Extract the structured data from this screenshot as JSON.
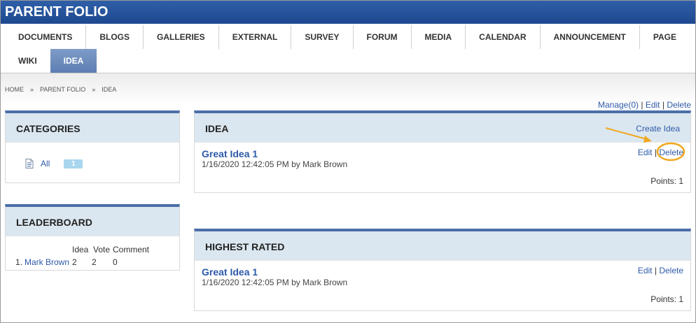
{
  "site": {
    "title": "PARENT FOLIO"
  },
  "nav": {
    "row1": [
      "DOCUMENTS",
      "BLOGS",
      "GALLERIES",
      "EXTERNAL",
      "SURVEY",
      "FORUM",
      "MEDIA",
      "CALENDAR",
      "ANNOUNCEMENT",
      "PAGE"
    ],
    "row2": [
      "WIKI",
      "IDEA"
    ],
    "active": "IDEA"
  },
  "breadcrumb": {
    "home": "HOME",
    "sep": "»",
    "parent": "PARENT FOLIO",
    "current": "IDEA"
  },
  "top_actions": {
    "manage": "Manage(0)",
    "sep": "|",
    "edit": "Edit",
    "delete": "Delete"
  },
  "categories": {
    "title": "CATEGORIES",
    "items": [
      {
        "label": "All",
        "count": "1",
        "icon": "document-icon"
      }
    ]
  },
  "leaderboard": {
    "title": "LEADERBOARD",
    "columns": [
      "Idea",
      "Vote",
      "Comment"
    ],
    "rows": [
      {
        "rank": "1.",
        "name": "Mark Brown",
        "idea": "2",
        "vote": "2",
        "comment": "0"
      }
    ]
  },
  "idea_panel": {
    "title": "IDEA",
    "create_label": "Create Idea",
    "item": {
      "title": "Great Idea 1",
      "meta": "1/16/2020 12:42:05 PM by Mark Brown",
      "edit": "Edit",
      "sep": "|",
      "delete": "Delete",
      "points": "Points: 1"
    }
  },
  "highest_rated": {
    "title": "HIGHEST RATED",
    "item": {
      "title": "Great Idea 1",
      "meta": "1/16/2020 12:42:05 PM by Mark Brown",
      "edit": "Edit",
      "sep": "|",
      "delete": "Delete",
      "points": "Points: 1"
    }
  },
  "colors": {
    "header": "#1e4890",
    "link": "#2e5aa8",
    "panel_head": "#dbe7f0",
    "annotation": "#f0a820"
  }
}
